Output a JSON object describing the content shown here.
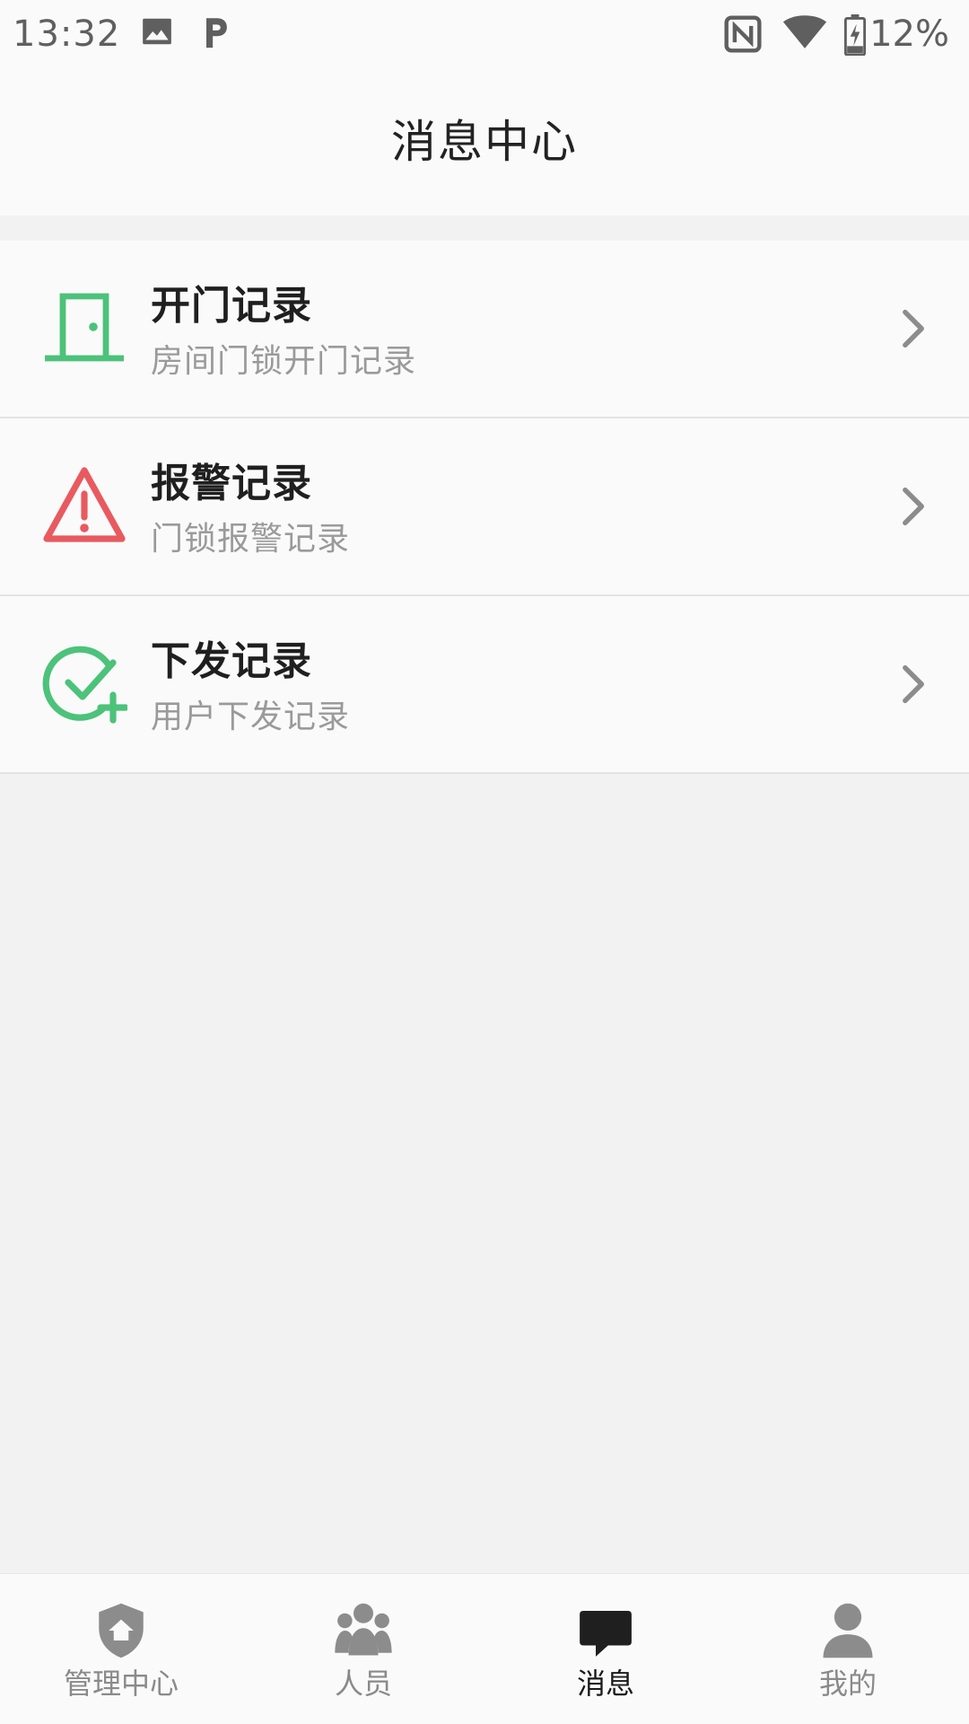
{
  "status_bar": {
    "time": "13:32",
    "battery": "12%",
    "icons": [
      "image-icon",
      "parking-icon",
      "nfc-icon",
      "wifi-icon",
      "battery-charging-icon"
    ]
  },
  "header": {
    "title": "消息中心"
  },
  "list": {
    "items": [
      {
        "title": "开门记录",
        "subtitle": "房间门锁开门记录",
        "icon": "door-icon",
        "icon_color": "#4cc27a"
      },
      {
        "title": "报警记录",
        "subtitle": "门锁报警记录",
        "icon": "warning-icon",
        "icon_color": "#e85a5f"
      },
      {
        "title": "下发记录",
        "subtitle": "用户下发记录",
        "icon": "check-plus-icon",
        "icon_color": "#4cc27a"
      }
    ]
  },
  "bottom_nav": {
    "active": 2,
    "items": [
      {
        "label": "管理中心",
        "icon": "shield-home-icon"
      },
      {
        "label": "人员",
        "icon": "people-icon"
      },
      {
        "label": "消息",
        "icon": "chat-bubble-icon"
      },
      {
        "label": "我的",
        "icon": "user-icon"
      }
    ]
  },
  "colors": {
    "accent_green": "#4cc27a",
    "alert_red": "#e85a5f",
    "background": "#f2f2f2",
    "surface": "#fafafa"
  }
}
